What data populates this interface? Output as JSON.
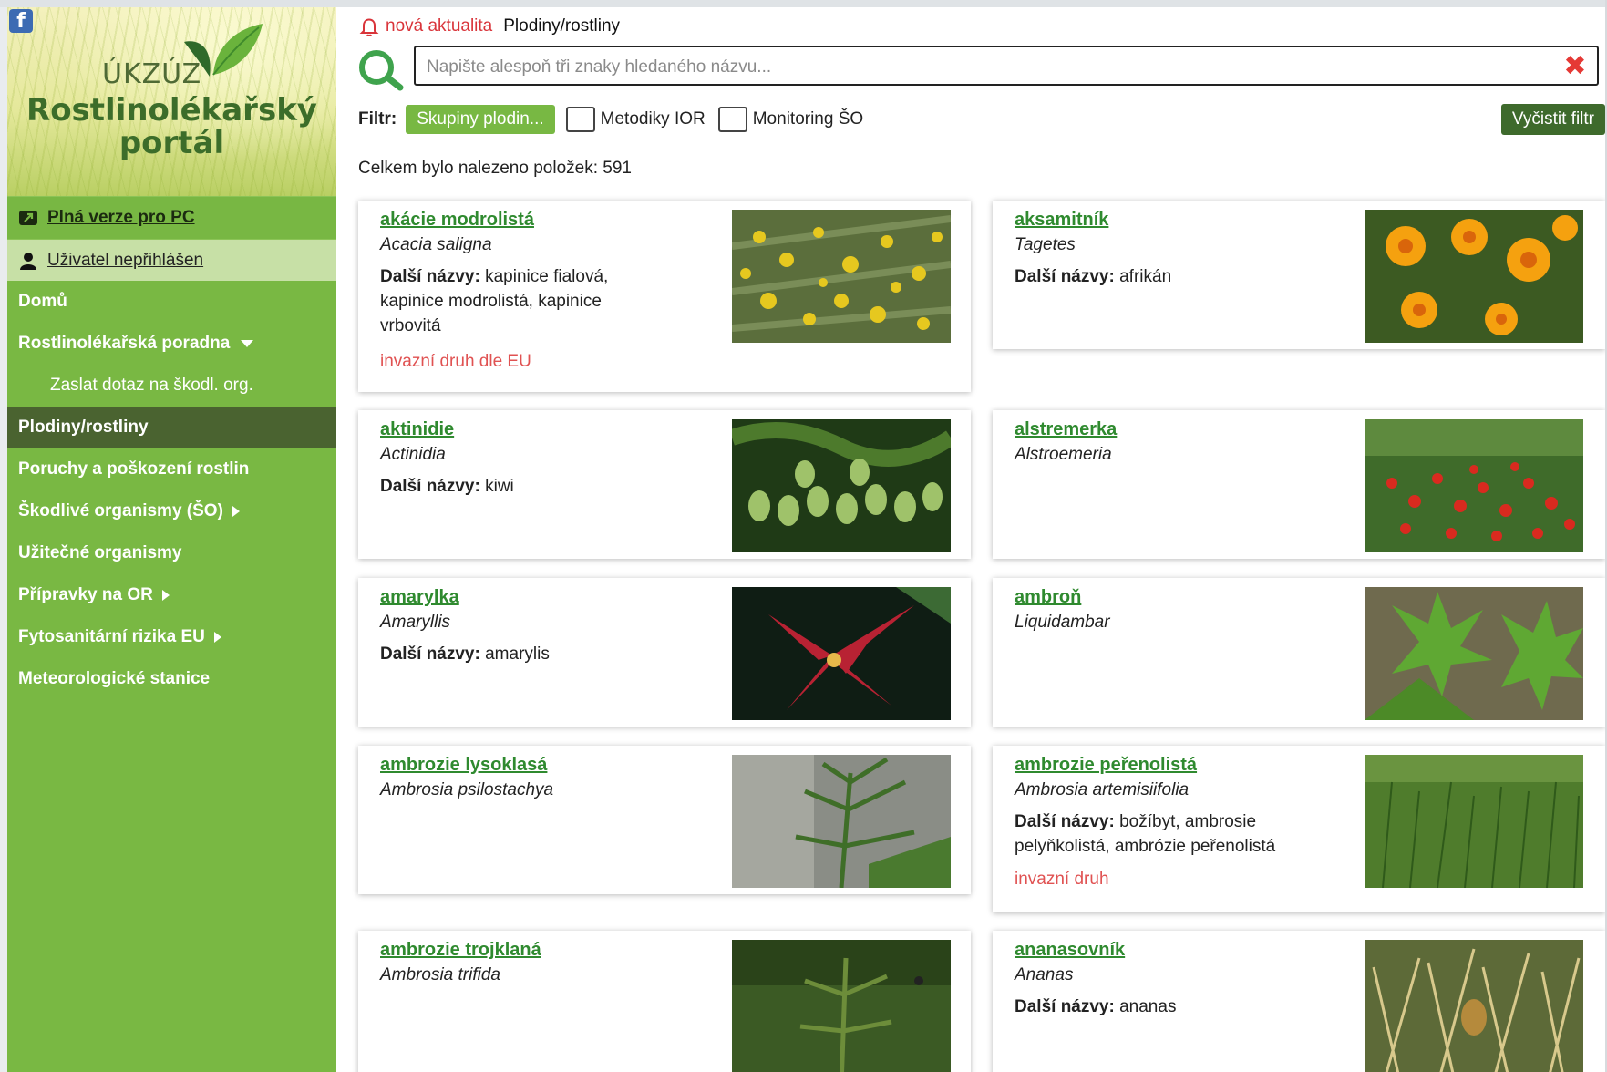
{
  "sidebar": {
    "facebook_icon": "facebook-icon",
    "brand_small": "ÚKZÚZ",
    "brand_line1": "Rostlinolékařský",
    "brand_line2": "portál",
    "pc_link": "Plná verze pro PC",
    "user_link": "Uživatel nepřihlášen",
    "nav": [
      {
        "label": "Domů"
      },
      {
        "label": "Rostlinolékařská poradna"
      },
      {
        "label": "Zaslat dotaz na škodl. org."
      },
      {
        "label": "Plodiny/rostliny"
      },
      {
        "label": "Poruchy a poškození rostlin"
      },
      {
        "label": "Škodlivé organismy (ŠO)"
      },
      {
        "label": "Užitečné organismy"
      },
      {
        "label": "Přípravky na OR"
      },
      {
        "label": "Fytosanitární rizika EU"
      },
      {
        "label": "Meteorologické stanice"
      }
    ],
    "colors": {
      "green": "#79b843",
      "active": "#4a6330",
      "user_bg": "#c7e0a6"
    }
  },
  "header": {
    "news": "nová aktualita",
    "breadcrumb": "Plodiny/rostliny"
  },
  "search": {
    "placeholder": "Napište alespoň tři znaky hledaného názvu...",
    "clear_icon": "✖"
  },
  "filter": {
    "label": "Filtr:",
    "groups_button": "Skupiny plodin...",
    "check1": "Metodiky IOR",
    "check2": "Monitoring ŠO",
    "clear_button": "Vyčistit filtr"
  },
  "results": {
    "total_label": "Celkem bylo nalezeno položek: 591"
  },
  "labels": {
    "other_names": "Další názvy:"
  },
  "cards": [
    {
      "title": "akácie modrolistá",
      "latin": "Acacia saligna",
      "other": "kapinice fialová, kapinice modrolistá, kapinice vrbovitá",
      "invasive": "invazní druh dle EU"
    },
    {
      "title": "aksamitník",
      "latin": "Tagetes",
      "other": "afrikán"
    },
    {
      "title": "aktinidie",
      "latin": "Actinidia",
      "other": "kiwi"
    },
    {
      "title": "alstremerka",
      "latin": "Alstroemeria"
    },
    {
      "title": "amarylka",
      "latin": "Amaryllis",
      "other": "amarylis"
    },
    {
      "title": "ambroň",
      "latin": "Liquidambar"
    },
    {
      "title": "ambrozie lysoklasá",
      "latin": "Ambrosia psilostachya"
    },
    {
      "title": "ambrozie peřenolistá",
      "latin": "Ambrosia artemisiifolia",
      "other": "božíbyt, ambrosie pelyňkolistá, ambrózie peřenolistá",
      "invasive": "invazní druh"
    },
    {
      "title": "ambrozie trojklaná",
      "latin": "Ambrosia trifida"
    },
    {
      "title": "ananasovník",
      "latin": "Ananas",
      "other": "ananas"
    }
  ]
}
